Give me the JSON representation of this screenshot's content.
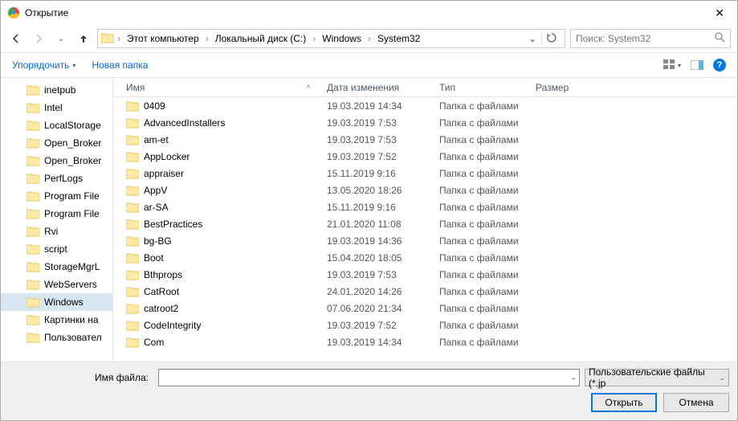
{
  "window": {
    "title": "Открытие"
  },
  "breadcrumbs": [
    "Этот компьютер",
    "Локальный диск (C:)",
    "Windows",
    "System32"
  ],
  "search": {
    "placeholder": "Поиск: System32"
  },
  "toolbar": {
    "organize": "Упорядочить",
    "newfolder": "Новая папка"
  },
  "headers": {
    "name": "Имя",
    "date": "Дата изменения",
    "type": "Тип",
    "size": "Размер"
  },
  "tree": [
    {
      "label": "inetpub"
    },
    {
      "label": "Intel"
    },
    {
      "label": "LocalStorage"
    },
    {
      "label": "Open_Broker"
    },
    {
      "label": "Open_Broker"
    },
    {
      "label": "PerfLogs"
    },
    {
      "label": "Program File"
    },
    {
      "label": "Program File"
    },
    {
      "label": "Rvi"
    },
    {
      "label": "script"
    },
    {
      "label": "StorageMgrL"
    },
    {
      "label": "WebServers"
    },
    {
      "label": "Windows",
      "selected": true
    },
    {
      "label": "Картинки на"
    },
    {
      "label": "Пользовател"
    }
  ],
  "rows": [
    {
      "name": "0409",
      "date": "19.03.2019 14:34",
      "type": "Папка с файлами"
    },
    {
      "name": "AdvancedInstallers",
      "date": "19.03.2019 7:53",
      "type": "Папка с файлами"
    },
    {
      "name": "am-et",
      "date": "19.03.2019 7:53",
      "type": "Папка с файлами"
    },
    {
      "name": "AppLocker",
      "date": "19.03.2019 7:52",
      "type": "Папка с файлами"
    },
    {
      "name": "appraiser",
      "date": "15.11.2019 9:16",
      "type": "Папка с файлами"
    },
    {
      "name": "AppV",
      "date": "13.05.2020 18:26",
      "type": "Папка с файлами"
    },
    {
      "name": "ar-SA",
      "date": "15.11.2019 9:16",
      "type": "Папка с файлами"
    },
    {
      "name": "BestPractices",
      "date": "21.01.2020 11:08",
      "type": "Папка с файлами"
    },
    {
      "name": "bg-BG",
      "date": "19.03.2019 14:36",
      "type": "Папка с файлами"
    },
    {
      "name": "Boot",
      "date": "15.04.2020 18:05",
      "type": "Папка с файлами"
    },
    {
      "name": "Bthprops",
      "date": "19.03.2019 7:53",
      "type": "Папка с файлами"
    },
    {
      "name": "CatRoot",
      "date": "24.01.2020 14:26",
      "type": "Папка с файлами"
    },
    {
      "name": "catroot2",
      "date": "07.06.2020 21:34",
      "type": "Папка с файлами"
    },
    {
      "name": "CodeIntegrity",
      "date": "19.03.2019 7:52",
      "type": "Папка с файлами"
    },
    {
      "name": "Com",
      "date": "19.03.2019 14:34",
      "type": "Папка с файлами"
    }
  ],
  "footer": {
    "filename_label": "Имя файла:",
    "filetype": "Пользовательские файлы (*.jp",
    "open": "Открыть",
    "cancel": "Отмена"
  }
}
